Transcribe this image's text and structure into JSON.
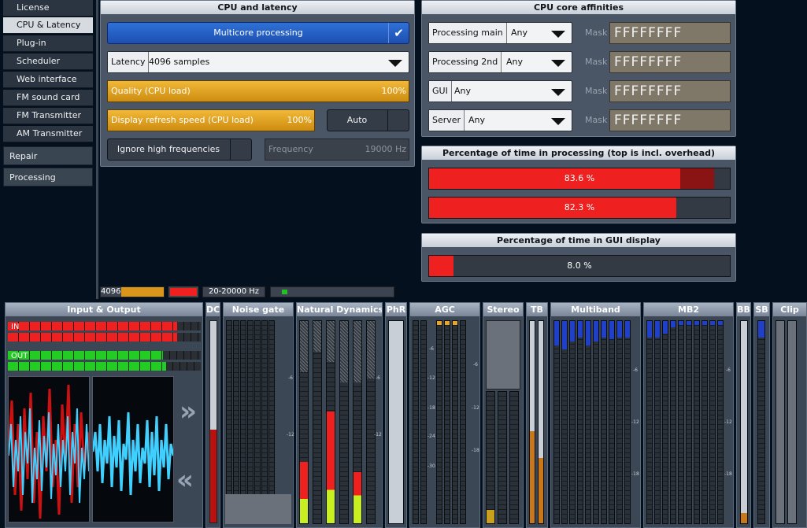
{
  "nav": {
    "items": [
      "License",
      "CPU & Latency",
      "Plug-in",
      "Scheduler",
      "Web interface",
      "FM sound card",
      "FM Transmitter",
      "AM Transmitter"
    ],
    "selected": "CPU & Latency",
    "groups": [
      "Repair",
      "Processing"
    ]
  },
  "cpu": {
    "title": "CPU and latency",
    "multicore_label": "Multicore processing",
    "latency_label": "Latency",
    "latency_value": "4096 samples",
    "quality_label": "Quality (CPU load)",
    "quality_value": "100%",
    "quality_level": 1.0,
    "refresh_label": "Display refresh speed (CPU load)",
    "refresh_value": "100%",
    "refresh_level": 1.0,
    "auto_label": "Auto",
    "ignore_label": "Ignore high frequencies",
    "frequency_label": "Frequency",
    "frequency_value": "19000 Hz"
  },
  "affinity": {
    "title": "CPU core affinities",
    "rows": [
      {
        "label": "Processing main",
        "value": "Any",
        "mask_label": "Mask",
        "mask": "FFFFFFFF"
      },
      {
        "label": "Processing 2nd",
        "value": "Any",
        "mask_label": "Mask",
        "mask": "FFFFFFFF"
      },
      {
        "label": "GUI",
        "value": "Any",
        "mask_label": "Mask",
        "mask": "FFFFFFFF"
      },
      {
        "label": "Server",
        "value": "Any",
        "mask_label": "Mask",
        "mask": "FFFFFFFF"
      }
    ]
  },
  "processing_time": {
    "title": "Percentage of time in processing (top is incl. overhead)",
    "bars": [
      {
        "text": "83.6 %",
        "level": 0.836,
        "overhead": 0.947
      },
      {
        "text": "82.3 %",
        "level": 0.823
      }
    ]
  },
  "gui_time": {
    "title": "Percentage of time in GUI display",
    "bar": {
      "text": "8.0 %",
      "level": 0.08
    }
  },
  "status": {
    "samples": "4096",
    "range": "20-20000 Hz"
  },
  "meters": {
    "io_title": "Input & Output",
    "in_label": "IN",
    "out_label": "OUT",
    "dc_title": "DC",
    "noise_gate_title": "Noise gate",
    "natural_dynamics_title": "Natural Dynamics",
    "phr_title": "PhR",
    "agc_title": "AGC",
    "stereo_title": "Stereo",
    "tb_title": "TB",
    "multiband_title": "Multiband",
    "mb2_title": "MB2",
    "bb_title": "BB",
    "sb_title": "SB",
    "clip_title": "Clip",
    "scale_ticks": [
      "-6",
      "-12",
      "-18",
      "-24",
      "-30"
    ]
  },
  "colors": {
    "accent_blue": "#2a66d0",
    "orange": "#e8a623",
    "red": "#ee2020",
    "green": "#22cc22",
    "mask_bg": "#7f7869"
  }
}
